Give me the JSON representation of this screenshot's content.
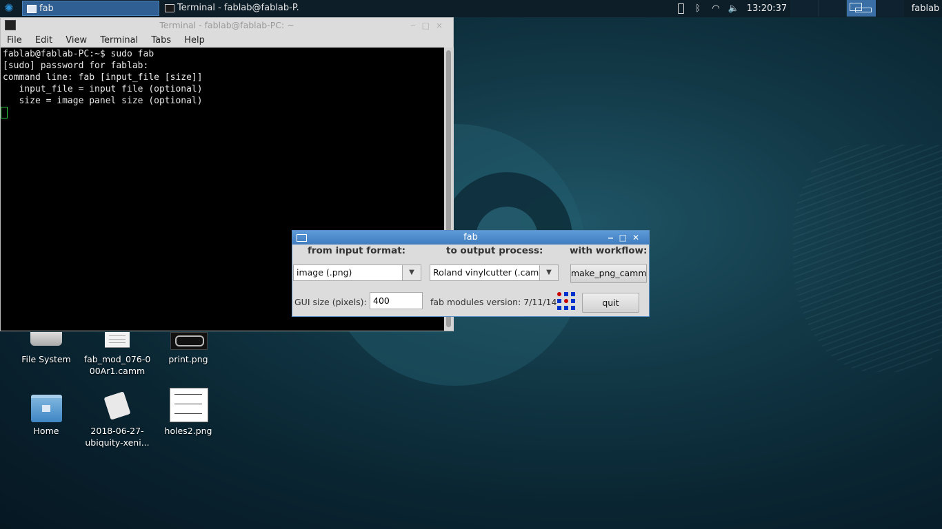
{
  "panel": {
    "tasks": [
      {
        "label": "fab"
      },
      {
        "label": "Terminal - fablab@fablab-P..."
      }
    ],
    "clock": "13:20:37",
    "user": "fablab"
  },
  "desktop": {
    "icons": [
      {
        "label": "File System"
      },
      {
        "label": "fab_mod_076-0 00Ar1.camm"
      },
      {
        "label": "print.png"
      },
      {
        "label": "Home"
      },
      {
        "label": "2018-06-27- ubiquity-xeni..."
      },
      {
        "label": "holes2.png"
      }
    ]
  },
  "terminal": {
    "title": "Terminal - fablab@fablab-PC: ~",
    "menu": [
      "File",
      "Edit",
      "View",
      "Terminal",
      "Tabs",
      "Help"
    ],
    "lines": [
      "fablab@fablab-PC:~$ sudo fab",
      "[sudo] password for fablab:",
      "command line: fab [input_file [size]]",
      "   input_file = input file (optional)",
      "   size = image panel size (optional)"
    ]
  },
  "fab": {
    "title": "fab",
    "input_header": "from input format:",
    "output_header": "to output process:",
    "workflow_header": "with workflow:",
    "input_value": "image (.png)",
    "output_value": "Roland vinylcutter (.camm)",
    "workflow_button": "make_png_camm",
    "gui_size_label": "GUI size (pixels):",
    "gui_size_value": "400",
    "version": "fab modules version: 7/11/14",
    "quit_button": "quit"
  }
}
